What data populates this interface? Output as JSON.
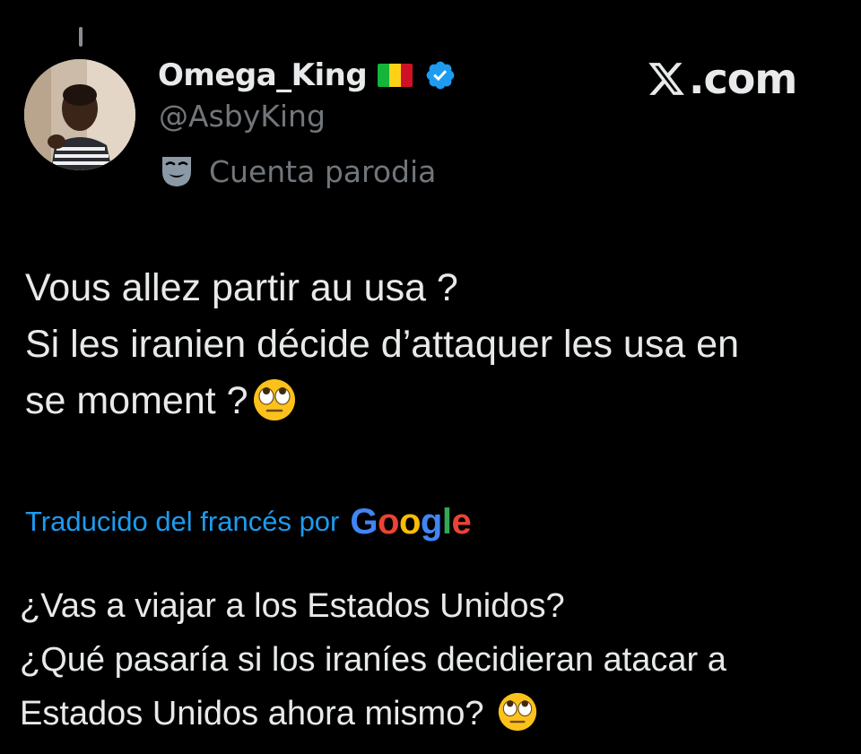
{
  "author": {
    "display_name": "Omega_King",
    "handle": "@AsbyKing",
    "account_label": "Cuenta parodia",
    "flag_colors": [
      "#14b53a",
      "#fcd116",
      "#ce1126"
    ],
    "verified_color": "#1d9bf0",
    "avatar_icon": "profile-photo"
  },
  "brand": {
    "text": ".com",
    "icon": "x-logo-icon"
  },
  "tweet": {
    "lines": [
      "Vous allez partir au usa ?",
      "Si les iranien décide d’attaquer les usa en",
      "se moment ?"
    ],
    "emoji": "face-with-rolling-eyes-icon"
  },
  "translation": {
    "label": "Traducido del francés por",
    "provider": "Google",
    "provider_colors": [
      "#4285f4",
      "#ea4335",
      "#fbbc05",
      "#4285f4",
      "#34a853",
      "#ea4335"
    ],
    "lines": [
      "¿Vas a viajar a los Estados Unidos?",
      "¿Qué pasaría si los iraníes decidieran atacar a",
      "Estados Unidos ahora mismo?"
    ]
  },
  "colors": {
    "background": "#000000",
    "text_primary": "#e7e9ea",
    "text_secondary": "#71767b",
    "accent": "#1d9bf0"
  }
}
